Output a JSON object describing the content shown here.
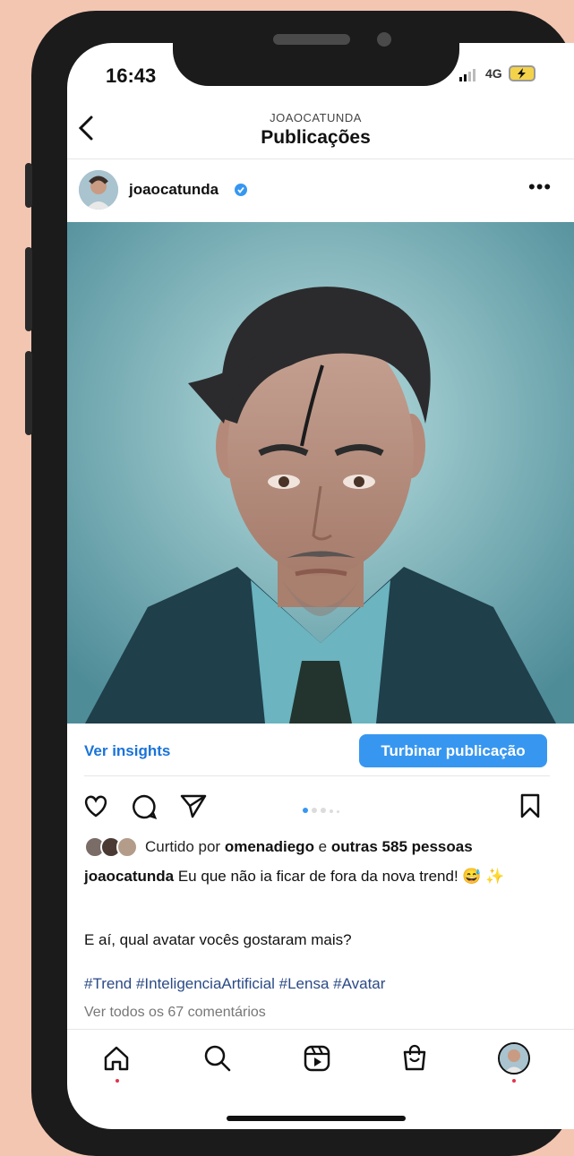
{
  "status_bar": {
    "time": "16:43",
    "network": "4G"
  },
  "header": {
    "subtitle": "JOAOCATUNDA",
    "title": "Publicações"
  },
  "post": {
    "username": "joaocatunda",
    "insights_label": "Ver insights",
    "boost_label": "Turbinar publicação",
    "likes_prefix": "Curtido por ",
    "likes_user": "omenadiego",
    "likes_mid": " e ",
    "likes_rest": "outras 585 pessoas",
    "caption_user": "joaocatunda",
    "caption_text": " Eu que não ia ficar de fora da nova trend! 😅 ✨",
    "question": "E aí, qual avatar vocês gostaram mais?",
    "hashtags": "#Trend #InteligenciaArtificial #Lensa #Avatar",
    "comments_link": "Ver todos os 67 comentários",
    "carousel": {
      "total": 5,
      "active": 1
    }
  },
  "bottom_nav": [
    "home-icon",
    "search-icon",
    "reels-icon",
    "shop-icon",
    "profile-avatar"
  ],
  "colors": {
    "accent": "#3797f0",
    "link": "#1a73d9",
    "hashtag": "#2b4a86",
    "background": "#f3c6b2"
  }
}
